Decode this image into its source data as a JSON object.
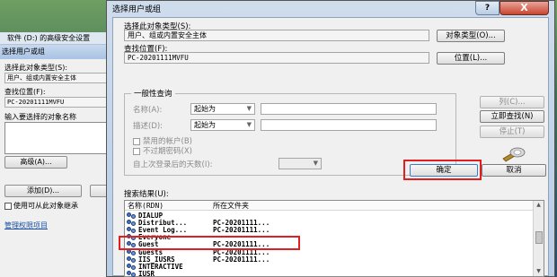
{
  "background_window": {
    "top_title": "软件 (D:) 的高级安全设置",
    "title": "选择用户或组",
    "object_type_label": "选择此对象类型(S):",
    "object_type_value": "用户、组或内置安全主体",
    "location_label": "查找位置(F):",
    "location_value": "PC-20201111MVFU",
    "enter_label": "输入要选择的对象名称",
    "advanced_button": "高级(A)...",
    "add_button": "添加(D)...",
    "checkbox_label": "使用可从此对象继承",
    "manage_link": "管理权限项目"
  },
  "dialog": {
    "title": "选择用户或组",
    "help": "?",
    "close": "X",
    "object_type_label": "选择此对象类型(S):",
    "object_type_value": "用户、组或内置安全主体",
    "object_type_button": "对象类型(O)...",
    "location_label": "查找位置(F):",
    "location_value": "PC-20201111MVFU",
    "location_button": "位置(L)...",
    "group_title": "一般性查询",
    "name_label": "名称(A):",
    "name_mode": "起始为",
    "desc_label": "描述(D):",
    "desc_mode": "起始为",
    "disabled_accounts": "禁用的帐户(B)",
    "no_expire": "不过期密码(X)",
    "days_label": "自上次登录后的天数(I):",
    "columns_button": "列(C)...",
    "find_now_button": "立即查找(N)",
    "stop_button": "停止(T)",
    "ok_button": "确定",
    "cancel_button": "取消",
    "results_label": "搜索结果(U):",
    "columns": {
      "name": "名称(RDN)",
      "folder": "所在文件夹"
    },
    "rows": [
      {
        "name": "DIALUP",
        "folder": ""
      },
      {
        "name": "Distribut...",
        "folder": "PC-20201111..."
      },
      {
        "name": "Event Log...",
        "folder": "PC-20201111..."
      },
      {
        "name": "Everyone",
        "folder": ""
      },
      {
        "name": "Guest",
        "folder": "PC-20201111..."
      },
      {
        "name": "Guests",
        "folder": "PC-20201111..."
      },
      {
        "name": "IIS_IUSRS",
        "folder": "PC-20201111..."
      },
      {
        "name": "INTERACTIVE",
        "folder": ""
      },
      {
        "name": "IUSR",
        "folder": ""
      }
    ]
  },
  "colors": {
    "highlight": "#e02020",
    "titlebar": "#b8cde6",
    "close": "#c9452f"
  }
}
